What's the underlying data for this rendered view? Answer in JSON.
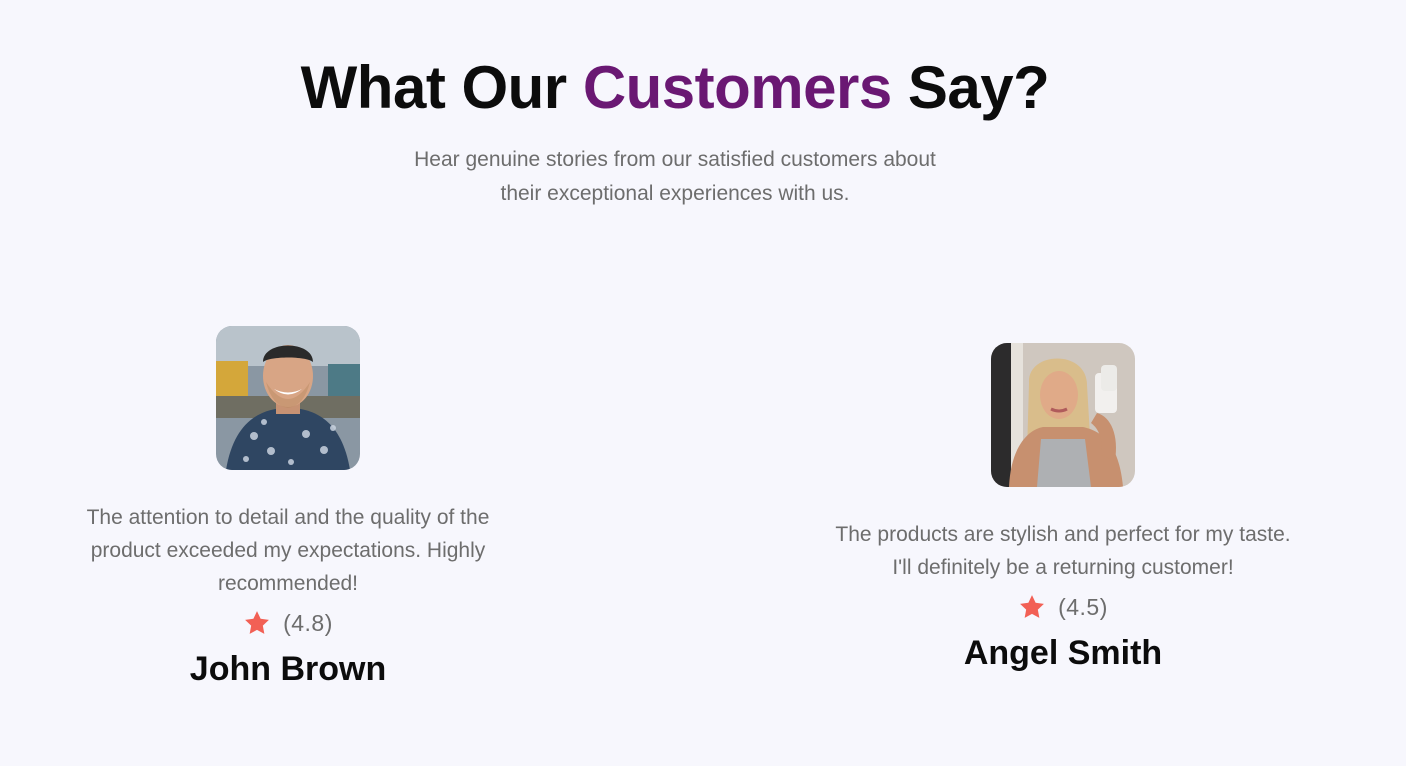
{
  "header": {
    "title_part1": "What Our ",
    "title_accent": "Customers",
    "title_part2": " Say?",
    "subtitle_line1": "Hear genuine stories from our satisfied customers about",
    "subtitle_line2": "their exceptional experiences with us."
  },
  "colors": {
    "accent": "#6a1873",
    "star": "#f26055",
    "text_muted": "#6d6d6d",
    "heading": "#0c0c0c",
    "background": "#f7f7fd"
  },
  "testimonials": [
    {
      "quote": "The attention to detail and the quality of the product exceeded my expectations. Highly recommended!",
      "rating": "(4.8)",
      "name": "John Brown",
      "avatar_icon": "avatar-photo"
    },
    {
      "quote": "The products are stylish and perfect for my taste. I'll definitely be a returning customer!",
      "rating": "(4.5)",
      "name": "Angel Smith",
      "avatar_icon": "avatar-photo"
    }
  ]
}
